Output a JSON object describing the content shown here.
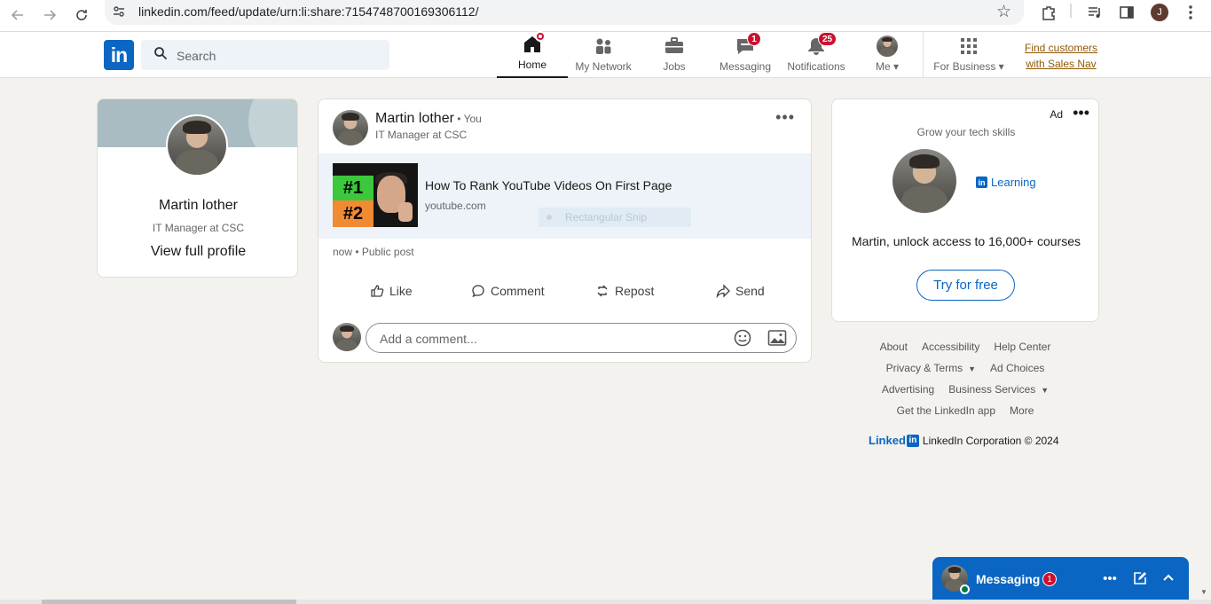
{
  "browser": {
    "url": "linkedin.com/feed/update/urn:li:share:7154748700169306112/",
    "profile_initial": "J"
  },
  "header": {
    "logo": "in",
    "search_placeholder": "Search",
    "nav": [
      {
        "label": "Home",
        "icon": "home-icon",
        "active": true,
        "dot": true
      },
      {
        "label": "My Network",
        "icon": "network-icon"
      },
      {
        "label": "Jobs",
        "icon": "jobs-icon"
      },
      {
        "label": "Messaging",
        "icon": "messaging-icon",
        "badge": "1"
      },
      {
        "label": "Notifications",
        "icon": "bell-icon",
        "badge": "25"
      },
      {
        "label": "Me",
        "icon": "avatar"
      },
      {
        "label": "For Business",
        "icon": "grid-icon"
      }
    ],
    "sales_nav": [
      "Find customers",
      "with Sales Nav"
    ]
  },
  "profile": {
    "name": "Martin lother",
    "title": "IT Manager at CSC",
    "link": "View full profile"
  },
  "post": {
    "author": "Martin lother",
    "you": " • You",
    "subtitle": "IT Manager at CSC",
    "link_title": "How To Rank YouTube Videos On First Page",
    "link_domain": "youtube.com",
    "thumb_labels": [
      "#1",
      "#2"
    ],
    "snip_overlay": "Rectangular Snip",
    "meta": "now • Public post",
    "actions": [
      "Like",
      "Comment",
      "Repost",
      "Send"
    ],
    "comment_placeholder": "Add a comment..."
  },
  "ad": {
    "label": "Ad",
    "heading": "Grow your tech skills",
    "learning": "Learning",
    "text": "Martin, unlock access to 16,000+ courses",
    "button": "Try for free"
  },
  "footer": {
    "row1": [
      "About",
      "Accessibility",
      "Help Center"
    ],
    "row2": [
      "Privacy & Terms",
      "Ad Choices"
    ],
    "row3": [
      "Advertising",
      "Business Services"
    ],
    "row4": [
      "Get the LinkedIn app",
      "More"
    ],
    "brand": "Linked",
    "corp": "LinkedIn Corporation © 2024"
  },
  "messaging": {
    "label": "Messaging",
    "badge": "1"
  },
  "colors": {
    "brand": "#0a66c2",
    "badge": "#cb112d",
    "page_bg": "#f4f2ee",
    "sales_nav": "#915907"
  }
}
